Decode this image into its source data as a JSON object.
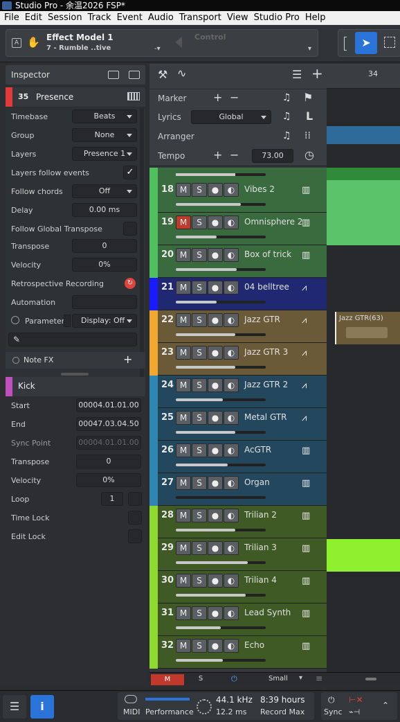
{
  "window": {
    "title": "Studio Pro - 余温2026 FSP*"
  },
  "menu": [
    "File",
    "Edit",
    "Session",
    "Track",
    "Event",
    "Audio",
    "Transport",
    "View",
    "Studio Pro",
    "Help"
  ],
  "toolbar": {
    "track_name": "Effect Model 1",
    "preset_name": "7 - Rumble ..tive",
    "control_label": "Control"
  },
  "inspector": {
    "title": "Inspector",
    "track": {
      "number": "35",
      "name": "Presence",
      "color": "#e03a3a"
    },
    "fields": [
      {
        "label": "Timebase",
        "value": "Beats"
      },
      {
        "label": "Group",
        "value": "None"
      },
      {
        "label": "Layers",
        "value": "Presence 1"
      },
      {
        "label": "Layers follow events",
        "value": ""
      },
      {
        "label": "Follow chords",
        "value": "Off"
      },
      {
        "label": "Delay",
        "value": "0.00 ms"
      },
      {
        "label": "Follow Global Transpose",
        "value": ""
      },
      {
        "label": "Transpose",
        "value": "0"
      },
      {
        "label": "Velocity",
        "value": "0%"
      },
      {
        "label": "Retrospective Recording",
        "value": ""
      },
      {
        "label": "Automation",
        "value": ""
      }
    ],
    "parameter_label": "Parameter",
    "display_value": "Display: Off",
    "note_fx": "Note FX",
    "event": {
      "name": "Kick",
      "color": "#c04fc0",
      "fields": [
        {
          "label": "Start",
          "value": "00004.01.01.00"
        },
        {
          "label": "End",
          "value": "00047.03.04.50"
        },
        {
          "label": "Sync Point",
          "value": "00004.01.01.00"
        },
        {
          "label": "Transpose",
          "value": "0"
        },
        {
          "label": "Velocity",
          "value": "0%"
        },
        {
          "label": "Loop",
          "value": "1"
        },
        {
          "label": "Time Lock",
          "value": ""
        },
        {
          "label": "Edit Lock",
          "value": ""
        }
      ]
    }
  },
  "global_tracks": [
    {
      "label": "Marker"
    },
    {
      "label": "Lyrics",
      "value": "Global"
    },
    {
      "label": "Arranger"
    },
    {
      "label": "Tempo",
      "value": "73.00"
    }
  ],
  "ruler": {
    "bar": "34"
  },
  "tracks": [
    {
      "num": "18",
      "name": "Vibes 2",
      "color": "#3a6b3e",
      "strip": "#4fbf5f",
      "icon": "midi",
      "muted": false,
      "fader": 0.72
    },
    {
      "num": "19",
      "name": "Omnisphere 2",
      "color": "#3a6b3e",
      "strip": "#4fbf5f",
      "icon": "midi",
      "muted": true,
      "fader": 0.45
    },
    {
      "num": "20",
      "name": "Box of trick",
      "color": "#3a6b3e",
      "strip": "#4fbf5f",
      "icon": "midi",
      "muted": false,
      "fader": 0.68
    },
    {
      "num": "21",
      "name": "04 belltree",
      "color": "#1f2870",
      "strip": "#1a1aff",
      "icon": "audio",
      "muted": false,
      "fader": 0.45
    },
    {
      "num": "22",
      "name": "Jazz GTR",
      "color": "#6b5a38",
      "strip": "#f0a830",
      "icon": "audio",
      "muted": false,
      "fader": 0.66
    },
    {
      "num": "23",
      "name": "Jazz GTR 3",
      "color": "#6b5a38",
      "strip": "#f0a830",
      "icon": "audio",
      "muted": false,
      "fader": 0.66
    },
    {
      "num": "24",
      "name": "Jazz GTR 2",
      "color": "#23485e",
      "strip": "#2f86b0",
      "icon": "audio",
      "muted": false,
      "fader": 0.52
    },
    {
      "num": "25",
      "name": "Metal GTR",
      "color": "#23485e",
      "strip": "#2f86b0",
      "icon": "audio",
      "muted": false,
      "fader": 0.66
    },
    {
      "num": "26",
      "name": "AcGTR",
      "color": "#23485e",
      "strip": "#2f86b0",
      "icon": "midi",
      "muted": false,
      "fader": 0.58
    },
    {
      "num": "27",
      "name": "Organ",
      "color": "#23485e",
      "strip": "#2f86b0",
      "icon": "midi",
      "muted": false,
      "fader": 0.0
    },
    {
      "num": "28",
      "name": "Trilian 2",
      "color": "#3f5a24",
      "strip": "#8ed82f",
      "icon": "midi",
      "muted": false,
      "fader": 0.66
    },
    {
      "num": "29",
      "name": "Trilian 3",
      "color": "#3f5a24",
      "strip": "#8ed82f",
      "icon": "midi",
      "muted": false,
      "fader": 0.8
    },
    {
      "num": "30",
      "name": "Trilian 4",
      "color": "#3f5a24",
      "strip": "#8ed82f",
      "icon": "midi",
      "muted": false,
      "fader": 0.78
    },
    {
      "num": "31",
      "name": "Lead Synth",
      "color": "#3f5a24",
      "strip": "#8ed82f",
      "icon": "midi",
      "muted": false,
      "fader": 0.5
    },
    {
      "num": "32",
      "name": "Echo",
      "color": "#3f5a24",
      "strip": "#8ed82f",
      "icon": "midi",
      "muted": false,
      "fader": 0.52
    }
  ],
  "clip": {
    "name": "Jazz GTR(63)"
  },
  "tracklist_footer": {
    "m": "M",
    "s": "S",
    "size": "Small"
  },
  "status": {
    "midi": "MIDI",
    "performance": "Performance",
    "sample_rate": "44.1 kHz",
    "latency": "12.2 ms",
    "record_time": "8:39 hours",
    "record_label": "Record Max",
    "sync": "Sync"
  }
}
